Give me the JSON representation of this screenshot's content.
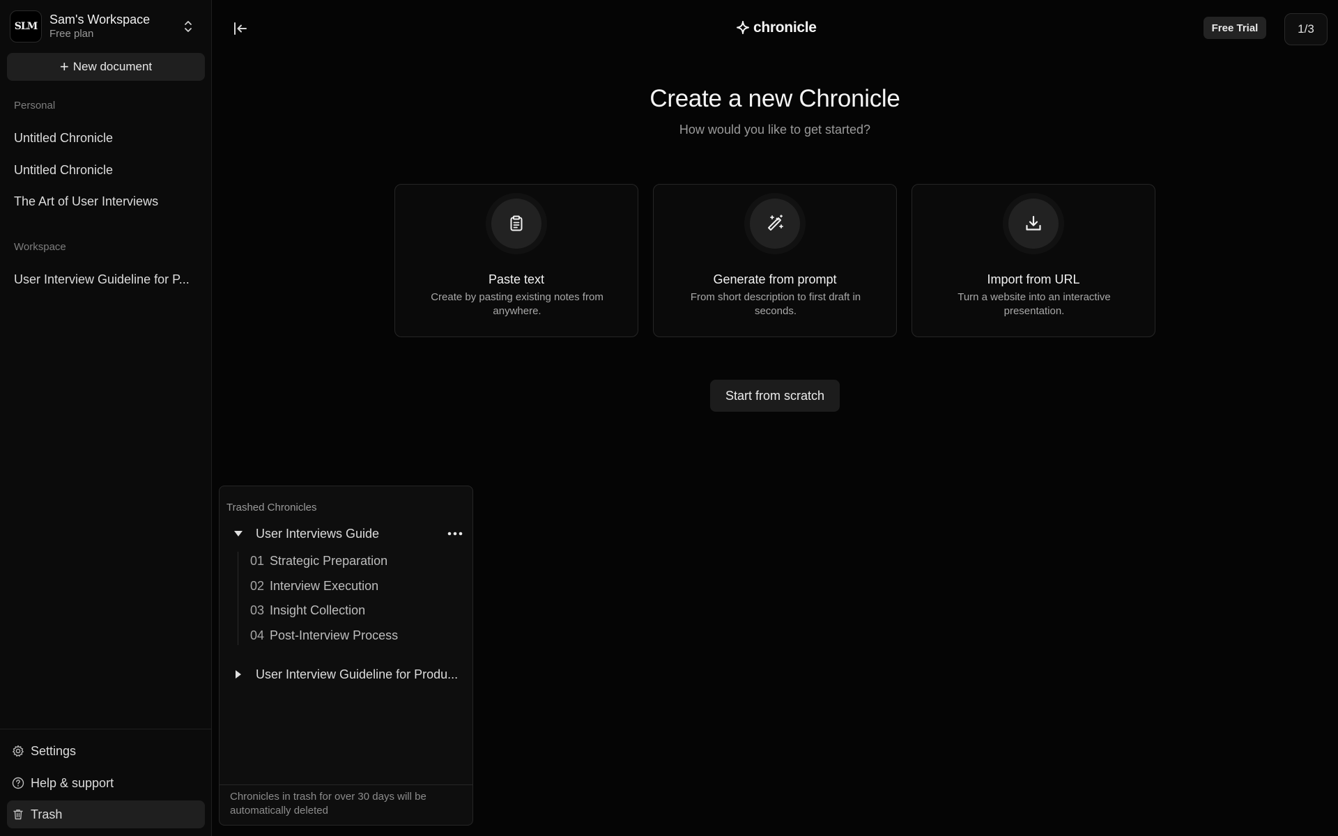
{
  "sidebar": {
    "workspace": {
      "logo_text": "SLM",
      "name": "Sam's Workspace",
      "plan": "Free plan"
    },
    "new_document_label": "New document",
    "personal_label": "Personal",
    "personal_items": [
      {
        "label": "Untitled Chronicle"
      },
      {
        "label": "Untitled Chronicle"
      },
      {
        "label": "The Art of User Interviews"
      }
    ],
    "workspace_label": "Workspace",
    "workspace_items": [
      {
        "label": "User Interview Guideline for P..."
      }
    ],
    "bottom": {
      "settings": "Settings",
      "help": "Help & support",
      "trash": "Trash"
    }
  },
  "header": {
    "brand": "chronicle",
    "free_trial": "Free Trial",
    "page_counter": "1/3"
  },
  "main": {
    "title": "Create a new Chronicle",
    "subtitle": "How would you like to get started?",
    "cards": [
      {
        "icon": "clipboard-icon",
        "title": "Paste text",
        "description": "Create by pasting existing notes from anywhere."
      },
      {
        "icon": "magic-wand-icon",
        "title": "Generate from prompt",
        "description": "From short description to first draft in seconds."
      },
      {
        "icon": "download-icon",
        "title": "Import from URL",
        "description": "Turn a website into an interactive presentation."
      }
    ],
    "start_from_scratch": "Start from scratch"
  },
  "trash_panel": {
    "heading": "Trashed Chronicles",
    "items": [
      {
        "label": "User Interviews Guide",
        "expanded": true,
        "children": [
          {
            "num": "01",
            "label": "Strategic Preparation"
          },
          {
            "num": "02",
            "label": "Interview Execution"
          },
          {
            "num": "03",
            "label": "Insight Collection"
          },
          {
            "num": "04",
            "label": "Post-Interview Process"
          }
        ]
      },
      {
        "label": "User Interview Guideline for Produ...",
        "expanded": false
      }
    ],
    "footer": "Chronicles in trash for over 30 days will be automatically deleted"
  },
  "colors": {
    "background": "#050505",
    "sidebar": "#0b0b0b",
    "button": "#1f1f1f",
    "text": "#e6e6e6",
    "muted": "#9a9a9a"
  }
}
